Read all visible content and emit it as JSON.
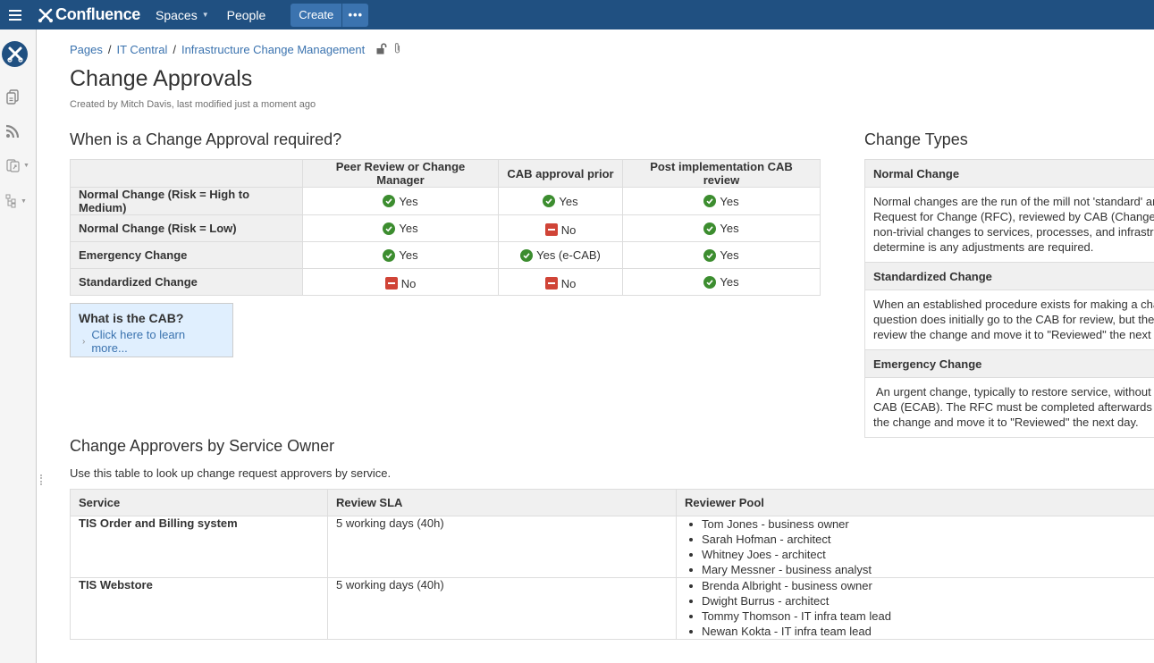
{
  "topnav": {
    "app_name": "Confluence",
    "spaces_label": "Spaces",
    "people_label": "People",
    "create_label": "Create",
    "more_label": "•••",
    "brand_color": "#205081",
    "button_color": "#3b73af"
  },
  "sidebar": {
    "icons": [
      "space-logo-icon",
      "pages-icon",
      "blog-feed-icon",
      "shortcuts-icon",
      "page-tree-icon"
    ]
  },
  "breadcrumb": {
    "items": [
      "Pages",
      "IT Central",
      "Infrastructure Change Management"
    ],
    "separator": "/"
  },
  "page": {
    "title": "Change Approvals",
    "byline": "Created by Mitch Davis, last modified just a moment ago"
  },
  "approval_section": {
    "heading": "When is a Change Approval required?",
    "columns": [
      "",
      "Peer Review or Change Manager",
      "CAB approval prior",
      "Post implementation CAB review"
    ],
    "rows": [
      {
        "label": "Normal Change (Risk = High to Medium)",
        "cells": [
          {
            "status": "yes",
            "text": "Yes"
          },
          {
            "status": "yes",
            "text": "Yes"
          },
          {
            "status": "yes",
            "text": "Yes"
          }
        ]
      },
      {
        "label": "Normal Change (Risk = Low)",
        "cells": [
          {
            "status": "yes",
            "text": "Yes"
          },
          {
            "status": "no",
            "text": "No"
          },
          {
            "status": "yes",
            "text": "Yes"
          }
        ]
      },
      {
        "label": "Emergency Change",
        "cells": [
          {
            "status": "yes",
            "text": "Yes"
          },
          {
            "status": "yes",
            "text": "Yes (e-CAB)"
          },
          {
            "status": "yes",
            "text": "Yes"
          }
        ]
      },
      {
        "label": "Standardized Change",
        "cells": [
          {
            "status": "no",
            "text": "No"
          },
          {
            "status": "no",
            "text": "No"
          },
          {
            "status": "yes",
            "text": "Yes"
          }
        ]
      }
    ],
    "yes_color": "#3c8d2f",
    "no_color": "#d04437"
  },
  "cab_panel": {
    "title": "What is the CAB?",
    "link": "Click here to learn more..."
  },
  "change_types": {
    "heading": "Change Types",
    "items": [
      {
        "title": "Normal Change",
        "lines": [
          "Normal changes are the run of the mill not 'standard' and",
          "Request for Change (RFC), reviewed by CAB (Change A",
          "non-trivial changes to services, processes, and infrastruc",
          "determine is any adjustments are required."
        ]
      },
      {
        "title": "Standardized Change",
        "lines": [
          "When an established procedure exists for making a char",
          "question does initially go to the CAB for review, but there",
          "review the change and move it to \"Reviewed\" the next da"
        ]
      },
      {
        "title": "Emergency Change",
        "lines": [
          " An urgent change, typically to restore service, without w",
          "CAB (ECAB). The RFC must be completed afterwards ar",
          "the change and move it to \"Reviewed\" the next day."
        ]
      }
    ]
  },
  "approvers_section": {
    "heading": "Change Approvers by Service Owner",
    "intro": "Use this table to look up change request approvers by service.",
    "columns": [
      "Service",
      "Review SLA",
      "Reviewer Pool"
    ],
    "rows": [
      {
        "service": "TIS Order and Billing system",
        "sla": "5 working days (40h)",
        "reviewers": [
          "Tom Jones - business owner",
          "Sarah Hofman - architect",
          "Whitney Joes - architect",
          "Mary Messner - business analyst"
        ]
      },
      {
        "service": "TIS Webstore",
        "sla": "5 working days (40h)",
        "reviewers": [
          "Brenda Albright - business owner",
          "Dwight Burrus - architect",
          "Tommy Thomson - IT infra team lead",
          "Newan Kokta - IT infra team lead"
        ]
      }
    ]
  }
}
